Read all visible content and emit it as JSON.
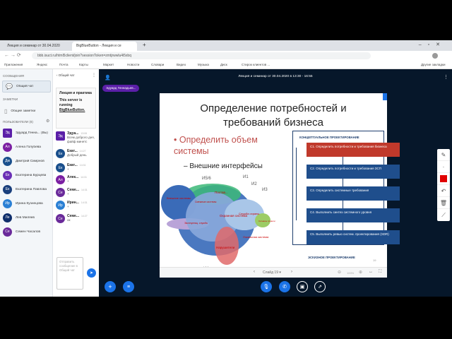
{
  "browser": {
    "tabs": [
      {
        "label": "Лекция и семинар от 30.04.2020"
      },
      {
        "label": "BigBlueButton - Лекция и се"
      }
    ],
    "new_tab": "+",
    "url": "bbb.isuct.ru/html5client/join?sessionToken=zmtjrwwlu4i5xbq",
    "bookmarks": [
      "Приложения",
      "Яндекс",
      "Почта",
      "Карты",
      "Маркет",
      "Новости",
      "Словари",
      "Видео",
      "Музыка",
      "Диск",
      "Стирок клиентов ...",
      "Другие закладки"
    ]
  },
  "sidebar": {
    "messages_header": "СООБЩЕНИЯ",
    "public_chat": "Общий чат",
    "notes_header": "ЗАМЕТКИ",
    "shared_notes": "Общие заметки",
    "users_header": "ПОЛЬЗОВАТЕЛИ (8)",
    "users": [
      {
        "initials": "Эд",
        "name": "Эдуард Генна... (Вы)",
        "color": "#5b1fa8"
      },
      {
        "initials": "Ал",
        "name": "Алена Голубева",
        "color": "#7b1fa2"
      },
      {
        "initials": "Дм",
        "name": "Дмитрий Смирнов",
        "color": "#1a4f8c"
      },
      {
        "initials": "Ек",
        "name": "Екатерина Бурцева",
        "color": "#6a2fb5"
      },
      {
        "initials": "Ек",
        "name": "Екатерина Павлова",
        "color": "#1a3f7c"
      },
      {
        "initials": "Ир",
        "name": "Ирина Кузнецова",
        "color": "#2a7fd4"
      },
      {
        "initials": "Ле",
        "name": "Лев Миляев",
        "color": "#0f2e6b"
      },
      {
        "initials": "Се",
        "name": "Семен Часалов",
        "color": "#6a2a9a"
      }
    ]
  },
  "chat": {
    "title": "Общий чат",
    "welcome_title": "Лекция и практика",
    "welcome_text": "This server is running",
    "welcome_link": "BigBlueButton.",
    "messages": [
      {
        "initials": "Эд",
        "name": "Эдуа...",
        "time": "13:06",
        "text": "Всем доброго дня, файф минетс",
        "color": "#5b1fa8"
      },
      {
        "initials": "Ек",
        "name": "Екат...",
        "time": "14:27",
        "text": "Добрый день",
        "color": "#1a4f8c"
      },
      {
        "initials": "Ек",
        "name": "Екат...",
        "time": "14:31",
        "text": "+",
        "color": "#1a4f8c"
      },
      {
        "initials": "Ал",
        "name": "Алек...",
        "time": "14:31",
        "text": "+",
        "color": "#7b1fa2"
      },
      {
        "initials": "Се",
        "name": "Семе...",
        "time": "14:31",
        "text": "+",
        "color": "#6a2a9a"
      },
      {
        "initials": "Ир",
        "name": "Ирин...",
        "time": "14:31",
        "text": "+",
        "color": "#2a7fd4"
      },
      {
        "initials": "Се",
        "name": "Семе...",
        "time": "14:27",
        "text": "ок",
        "color": "#6a2a9a"
      }
    ],
    "input_placeholder": "Отправить сообщение в Общий чат"
  },
  "main": {
    "meeting_title": "Лекция и семинар от 30.04.2020 в 13:30 - 16:55",
    "presenter": "Эдуард Геннадьев...",
    "slide": {
      "title_line1": "Определение потребностей и",
      "title_line2": "требований бизнеса",
      "bullet": "Определить объем системы",
      "sub_bullet": "– Внешние интерфейсы",
      "diagram_labels": [
        "И5/6",
        "И1",
        "И2",
        "И3",
        "И4",
        "Постав...",
        "Охранная система",
        "Нарушители",
        "Локальная система",
        "Служба охраны",
        "Смежные системы",
        "Эксплуатац. служба",
        "Сигналы тревоги",
        "Внешние системы"
      ],
      "flow_header": "КОНЦЕПТУАЛЬНОЕ ПРОЕКТИРОВАНИЕ",
      "steps": [
        {
          "code": "C1.",
          "text": "Определить потребности и требования бизнеса",
          "color": "#c0392b"
        },
        {
          "code": "C2.",
          "text": "Определить потребности и требования ЗСП",
          "color": "#1f4e8c"
        },
        {
          "code": "C3.",
          "text": "Определить системные требования",
          "color": "#1f4e8c"
        },
        {
          "code": "C4.",
          "text": "Выполнить синтез системного уровня",
          "color": "#1f4e8c"
        },
        {
          "code": "C5.",
          "text": "Выполнить ревью систем. проектирования (SDR)",
          "color": "#1f4e8c"
        }
      ],
      "flow_footer": "ЭСКИЗНОЕ ПРОЕКТИРОВАНИЕ",
      "page_number": "19"
    },
    "slide_nav": {
      "label": "Слайд 19",
      "zoom": "100%"
    }
  },
  "colors": {
    "accent": "#1b73e8",
    "main_bg": "#06172a",
    "pen": "#e00000"
  }
}
